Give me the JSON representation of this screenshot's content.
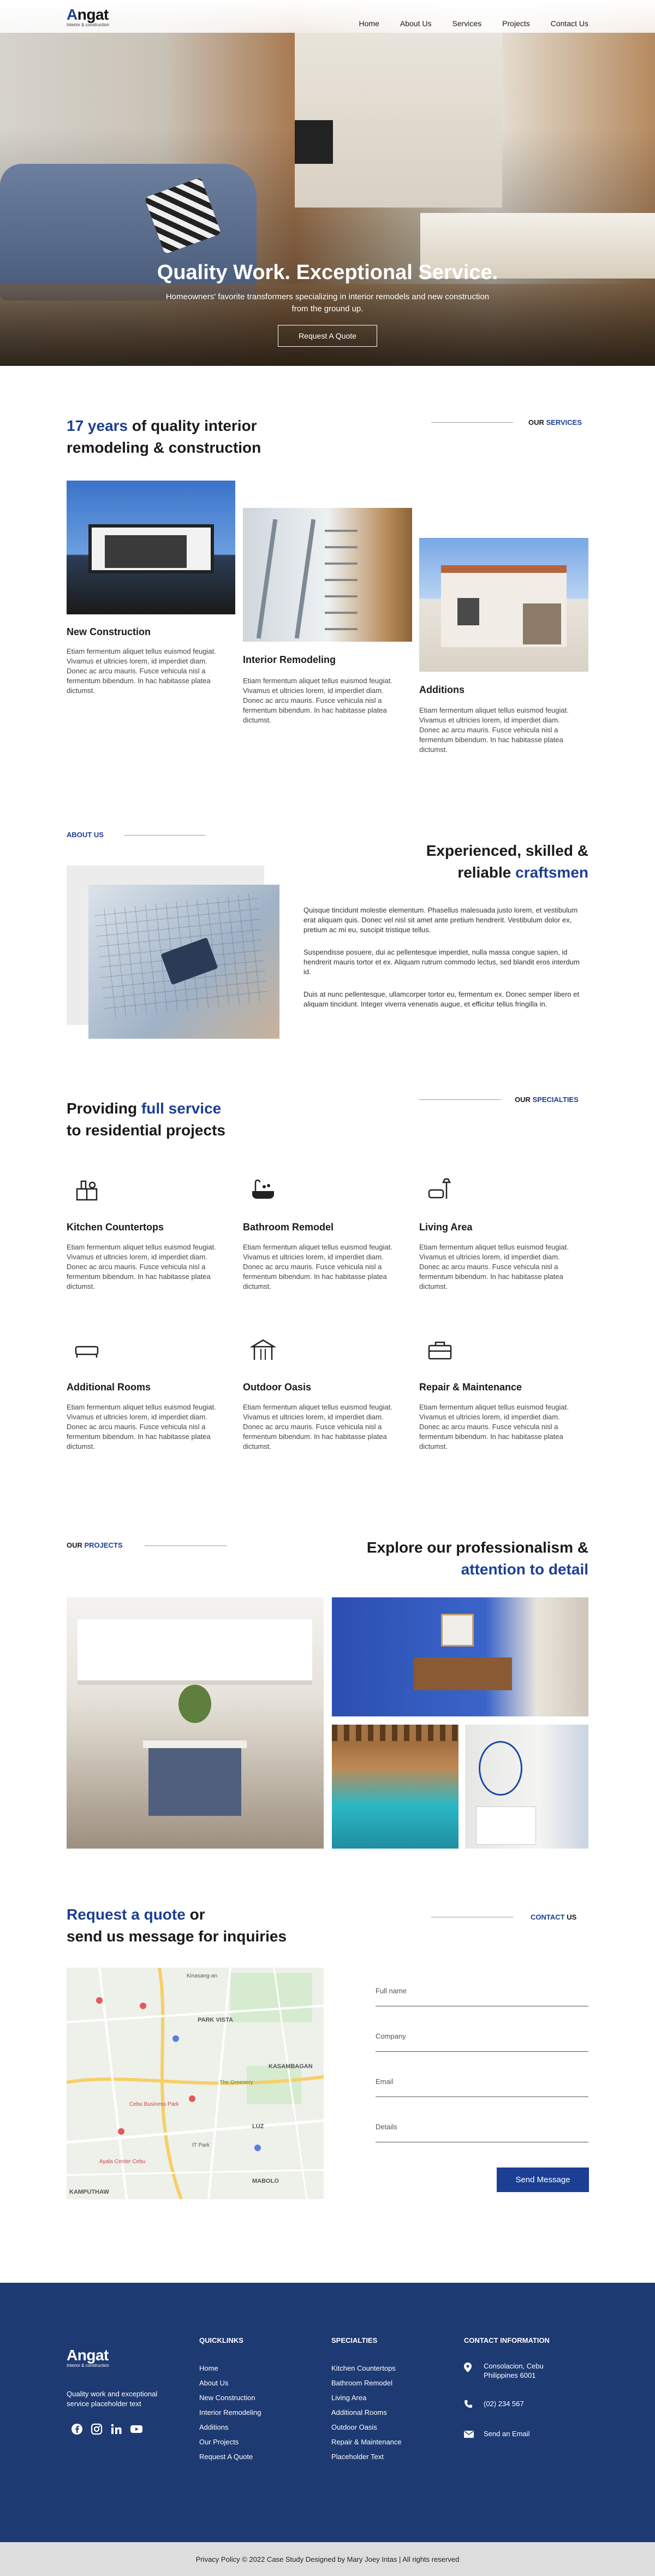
{
  "brand": {
    "name_first": "A",
    "name_rest": "ngat",
    "tagline": "Interior & construction"
  },
  "nav": [
    "Home",
    "About Us",
    "Services",
    "Projects",
    "Contact Us"
  ],
  "hero": {
    "title": "Quality Work. Exceptional Service.",
    "subtitle": "Homeowners' favorite transformers specializing in interior remodels and new construction from the ground up.",
    "button": "Request A Quote"
  },
  "services": {
    "tag_our": "OUR ",
    "tag_word": "SERVICES",
    "heading_highlight": "17 years",
    "heading_rest1": " of quality interior",
    "heading_rest2": "remodeling & construction",
    "cards": [
      {
        "title": "New Construction",
        "text": "Etiam fermentum aliquet tellus euismod feugiat. Vivamus et ultricies lorem, id imperdiet diam. Donec ac arcu mauris. Fusce vehicula nisl a fermentum bibendum. In hac habitasse platea dictumst."
      },
      {
        "title": "Interior Remodeling",
        "text": "Etiam fermentum aliquet tellus euismod feugiat. Vivamus et ultricies lorem, id imperdiet diam. Donec ac arcu mauris. Fusce vehicula nisl a fermentum bibendum. In hac habitasse platea dictumst."
      },
      {
        "title": "Additions",
        "text": "Etiam fermentum aliquet tellus euismod feugiat. Vivamus et ultricies lorem, id imperdiet diam. Donec ac arcu mauris. Fusce vehicula nisl a fermentum bibendum. In hac habitasse platea dictumst."
      }
    ]
  },
  "about": {
    "tag_our": "ABOUT ",
    "tag_word": "US",
    "heading1": "Experienced, skilled &",
    "heading2a": "reliable ",
    "heading2b": "craftsmen",
    "paragraphs": [
      "Quisque tincidunt molestie elementum. Phasellus malesuada justo lorem, et vestibulum erat aliquam quis. Donec vel nisl sit amet ante pretium hendrerit. Vestibulum dolor ex, pretium ac mi eu, suscipit tristique tellus.",
      "Suspendisse posuere, dui ac pellentesque imperdiet, nulla massa congue sapien, id hendrerit mauris tortor et ex. Aliquam rutrum commodo lectus, sed blandit eros interdum id.",
      "Duis at nunc pellentesque, ullamcorper tortor eu, fermentum ex. Donec semper libero et aliquam tincidunt. Integer viverra venenatis augue, et efficitur tellus fringilla in."
    ]
  },
  "specialties": {
    "tag_our": "OUR ",
    "tag_word": "SPECIALTIES",
    "heading1a": "Providing ",
    "heading1b": "full service",
    "heading2": "to residential projects",
    "items": [
      {
        "title": "Kitchen Countertops",
        "icon": "countertop-icon",
        "text": "Etiam fermentum aliquet tellus euismod feugiat. Vivamus et ultricies lorem, id imperdiet diam. Donec ac arcu mauris. Fusce vehicula nisl a fermentum bibendum. In hac habitasse platea dictumst."
      },
      {
        "title": "Bathroom Remodel",
        "icon": "bathtub-icon",
        "text": "Etiam fermentum aliquet tellus euismod feugiat. Vivamus et ultricies lorem, id imperdiet diam. Donec ac arcu mauris. Fusce vehicula nisl a fermentum bibendum. In hac habitasse platea dictumst."
      },
      {
        "title": "Living Area",
        "icon": "sofa-lamp-icon",
        "text": "Etiam fermentum aliquet tellus euismod feugiat. Vivamus et ultricies lorem, id imperdiet diam. Donec ac arcu mauris. Fusce vehicula nisl a fermentum bibendum. In hac habitasse platea dictumst."
      },
      {
        "title": "Additional Rooms",
        "icon": "bed-icon",
        "text": "Etiam fermentum aliquet tellus euismod feugiat. Vivamus et ultricies lorem, id imperdiet diam. Donec ac arcu mauris. Fusce vehicula nisl a fermentum bibendum. In hac habitasse platea dictumst."
      },
      {
        "title": "Outdoor Oasis",
        "icon": "gazebo-icon",
        "text": "Etiam fermentum aliquet tellus euismod feugiat. Vivamus et ultricies lorem, id imperdiet diam. Donec ac arcu mauris. Fusce vehicula nisl a fermentum bibendum. In hac habitasse platea dictumst."
      },
      {
        "title": "Repair & Maintenance",
        "icon": "toolbox-icon",
        "text": "Etiam fermentum aliquet tellus euismod feugiat. Vivamus et ultricies lorem, id imperdiet diam. Donec ac arcu mauris. Fusce vehicula nisl a fermentum bibendum. In hac habitasse platea dictumst."
      }
    ]
  },
  "projects": {
    "tag_our": "OUR ",
    "tag_word": "PROJECTS",
    "heading1": "Explore our professionalism &",
    "heading2": "attention to detail"
  },
  "contact": {
    "tag_word": "CONTACT",
    "tag_us": " US",
    "heading1a": "Request a quote",
    "heading1b": " or",
    "heading2": "send us message for inquiries",
    "fields": [
      "Full name",
      "Company",
      "Email",
      "Details"
    ],
    "button": "Send Message",
    "map_labels": [
      "PARK VISTA",
      "KASAMBAGAN",
      "LUZ",
      "MABOLO",
      "KAMPUTHAW",
      "Ayala Center Cebu",
      "Cebu Business Park",
      "The Greenery",
      "Kinasang-an",
      "IT Park"
    ]
  },
  "footer": {
    "tagline": "Quality work and exceptional service placeholder text",
    "social_icons": [
      "facebook-icon",
      "instagram-icon",
      "linkedin-icon",
      "youtube-icon"
    ],
    "quicklinks_title": "QUICKLINKS",
    "quicklinks": [
      "Home",
      "About Us",
      "New Construction",
      "Interior Remodeling",
      "Additions",
      "Our Projects",
      "Request A Quote"
    ],
    "specialties_title": "SPECIALTIES",
    "specialties": [
      "Kitchen Countertops",
      "Bathroom Remodel",
      "Living Area",
      "Additional Rooms",
      "Outdoor Oasis",
      "Repair & Maintenance",
      "Placeholder Text"
    ],
    "contact_title": "CONTACT INFORMATION",
    "address": "Consolacion, Cebu Philippines 6001",
    "phone": "(02) 234 567",
    "email": "Send an Email",
    "copyright": "Privacy Policy © 2022 Case Study Designed by Mary Joey Intas | All rights reserved"
  },
  "colors": {
    "accent": "#1c3f94",
    "footer_bg": "#1e3a73",
    "bottom_bar": "#dddddd"
  }
}
